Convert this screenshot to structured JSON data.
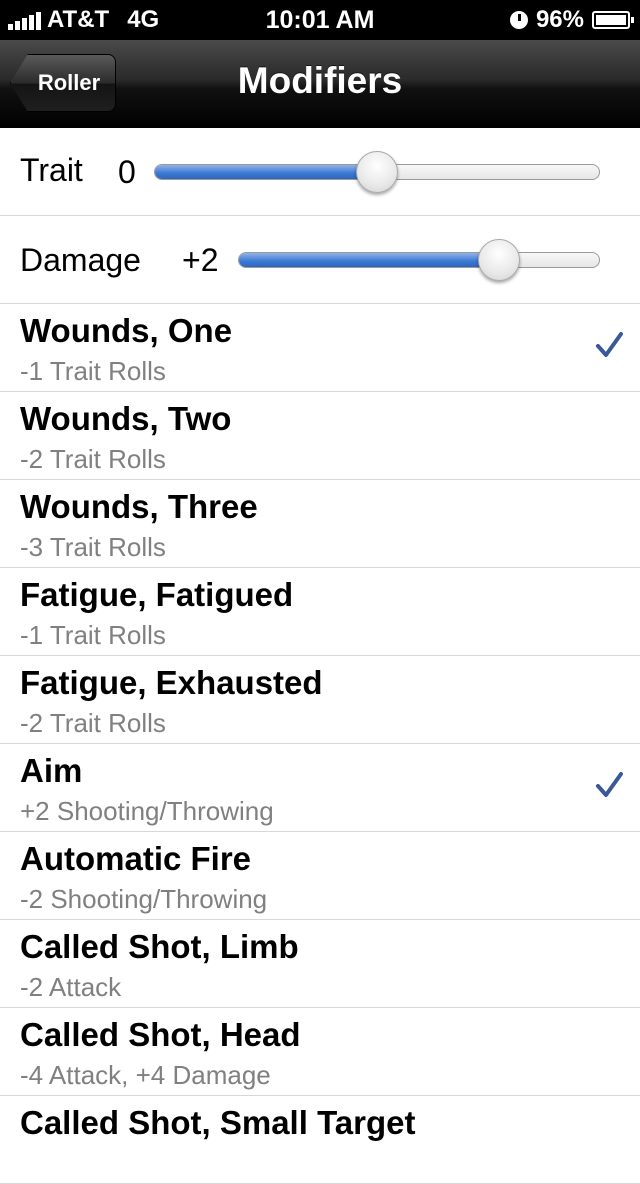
{
  "status_bar": {
    "carrier": "AT&T",
    "network": "4G",
    "time": "10:01 AM",
    "battery_percent": "96%",
    "icons": [
      "signal-icon",
      "clock-icon",
      "battery-icon"
    ]
  },
  "nav": {
    "back_label": "Roller",
    "title": "Modifiers"
  },
  "sliders": [
    {
      "label": "Trait",
      "value": "0",
      "fill_fraction": 0.5
    },
    {
      "label": "Damage",
      "value": "+2",
      "fill_fraction": 0.72
    }
  ],
  "modifiers": [
    {
      "title": "Wounds, One",
      "subtitle": "-1 Trait Rolls",
      "checked": true
    },
    {
      "title": "Wounds, Two",
      "subtitle": "-2 Trait Rolls",
      "checked": false
    },
    {
      "title": "Wounds, Three",
      "subtitle": "-3 Trait Rolls",
      "checked": false
    },
    {
      "title": "Fatigue, Fatigued",
      "subtitle": "-1 Trait Rolls",
      "checked": false
    },
    {
      "title": "Fatigue, Exhausted",
      "subtitle": "-2 Trait Rolls",
      "checked": false
    },
    {
      "title": "Aim",
      "subtitle": "+2 Shooting/Throwing",
      "checked": true
    },
    {
      "title": "Automatic Fire",
      "subtitle": "-2 Shooting/Throwing",
      "checked": false
    },
    {
      "title": "Called Shot, Limb",
      "subtitle": "-2 Attack",
      "checked": false
    },
    {
      "title": "Called Shot, Head",
      "subtitle": "-4 Attack, +4 Damage",
      "checked": false
    },
    {
      "title": "Called Shot, Small Target",
      "subtitle": "",
      "checked": false
    }
  ],
  "colors": {
    "checkmark": "#3a5998",
    "slider_fill": "#3a78d4",
    "subtitle": "#808080"
  }
}
